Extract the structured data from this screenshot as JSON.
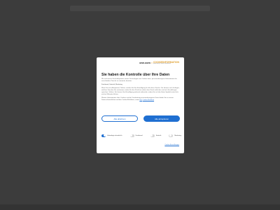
{
  "header": {
    "logo_main": "one.com",
    "logo_sep": "×",
    "logo_cookie": "COOKIEINFORMATION",
    "logo_sub": "powered by Cookie Information"
  },
  "dialog": {
    "title": "Sie haben die Kontrolle über Ihre Daten",
    "intro": "Wir und unsere Geschäftspartner nutzen Technologien wie Cookies dazu, personenbezogene Informationen für verschiedene Zwecke zu sammeln, darunter:",
    "purposes": "Funktional, Statistik, Marketing",
    "details_text": "Wenn Sie auf „Akzeptieren“ klicken, erteilen Sie Ihre Einwilligung für alle diese Zwecke. Sie können auch festlegen, welchen Zwecken Sie zustimmen, indem Sie das Kästchen neben dem Zweck anklicken und auf „Einstellungen speichern“ klicken. Sie können Ihre Einwilligung jederzeit widerrufen, indem Sie auf das kleine Symbol unten links auf der Webseite klicken.",
    "more_text": "Weitere Informationen über Cookies und die Verarbeitung personenbezogener Daten finden Sie in unserer Datenschutzrichtlinie und den Cookie-Richtlinien, sowie",
    "policy_link": "hier",
    "policy_link2": "Cookie-Richtlinie"
  },
  "buttons": {
    "reject": "Alle ablehnen",
    "accept": "Alle akzeptieren"
  },
  "toggles": [
    {
      "label": "Unbedingt erforderlich",
      "on": true
    },
    {
      "label": "Funktional",
      "on": false
    },
    {
      "label": "Statistik",
      "on": false
    },
    {
      "label": "Marketing",
      "on": false
    }
  ],
  "footer": {
    "details_link": "Cookie-Einstellungen"
  },
  "colors": {
    "accent": "#1f6fd1",
    "backdrop": "#3c3c3c",
    "cookie_brand": "#e0a030"
  }
}
